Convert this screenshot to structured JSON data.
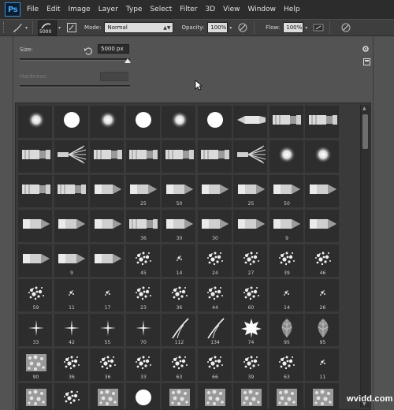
{
  "app": {
    "logo_text": "Ps"
  },
  "menu": [
    "File",
    "Edit",
    "Image",
    "Layer",
    "Type",
    "Select",
    "Filter",
    "3D",
    "View",
    "Window",
    "Help"
  ],
  "options_bar": {
    "brush_size_value": "5000",
    "mode_label": "Mode:",
    "mode_value": "Normal",
    "opacity_label": "Opacity:",
    "opacity_value": "100%",
    "flow_label": "Flow:",
    "flow_value": "100%"
  },
  "brush_panel": {
    "size_label": "Size:",
    "size_value": "5000 px",
    "hardness_label": "Hardness:",
    "hardness_value": ""
  },
  "brush_presets": [
    {
      "kind": "soft-round",
      "num": ""
    },
    {
      "kind": "hard-round",
      "num": ""
    },
    {
      "kind": "soft-round",
      "num": ""
    },
    {
      "kind": "hard-round",
      "num": ""
    },
    {
      "kind": "soft-round",
      "num": ""
    },
    {
      "kind": "hard-round",
      "num": ""
    },
    {
      "kind": "brush-tip",
      "num": ""
    },
    {
      "kind": "brush-flat",
      "num": ""
    },
    {
      "kind": "brush-flat",
      "num": ""
    },
    {
      "kind": "brush-flat",
      "num": ""
    },
    {
      "kind": "fan",
      "num": ""
    },
    {
      "kind": "brush-flat",
      "num": ""
    },
    {
      "kind": "brush-flat",
      "num": ""
    },
    {
      "kind": "brush-flat",
      "num": ""
    },
    {
      "kind": "brush-flat",
      "num": ""
    },
    {
      "kind": "fan",
      "num": ""
    },
    {
      "kind": "soft-round",
      "num": ""
    },
    {
      "kind": "soft-round",
      "num": ""
    },
    {
      "kind": "brush-flat",
      "num": ""
    },
    {
      "kind": "brush-flat",
      "num": ""
    },
    {
      "kind": "pencil",
      "num": ""
    },
    {
      "kind": "pencil",
      "num": "25"
    },
    {
      "kind": "pencil",
      "num": "50"
    },
    {
      "kind": "pencil",
      "num": ""
    },
    {
      "kind": "pencil",
      "num": "25"
    },
    {
      "kind": "pencil",
      "num": "50"
    },
    {
      "kind": "pencil",
      "num": ""
    },
    {
      "kind": "pencil",
      "num": ""
    },
    {
      "kind": "pencil",
      "num": ""
    },
    {
      "kind": "pencil",
      "num": ""
    },
    {
      "kind": "brush-flat",
      "num": "36"
    },
    {
      "kind": "pencil",
      "num": "30"
    },
    {
      "kind": "pencil",
      "num": "30"
    },
    {
      "kind": "pencil",
      "num": ""
    },
    {
      "kind": "pencil",
      "num": "9"
    },
    {
      "kind": "pencil",
      "num": ""
    },
    {
      "kind": "pencil",
      "num": ""
    },
    {
      "kind": "pencil",
      "num": "9"
    },
    {
      "kind": "pencil",
      "num": ""
    },
    {
      "kind": "spatter",
      "num": "45"
    },
    {
      "kind": "spatter-s",
      "num": "14"
    },
    {
      "kind": "spatter",
      "num": "24"
    },
    {
      "kind": "spatter",
      "num": "27"
    },
    {
      "kind": "spatter",
      "num": "39"
    },
    {
      "kind": "spatter",
      "num": "46"
    },
    {
      "kind": "spatter",
      "num": "59"
    },
    {
      "kind": "spatter-s",
      "num": "11"
    },
    {
      "kind": "spatter-s",
      "num": "17"
    },
    {
      "kind": "spatter",
      "num": "23"
    },
    {
      "kind": "spatter",
      "num": "36"
    },
    {
      "kind": "spatter",
      "num": "44"
    },
    {
      "kind": "spatter",
      "num": "60"
    },
    {
      "kind": "spatter-s",
      "num": "14"
    },
    {
      "kind": "spatter-s",
      "num": "26"
    },
    {
      "kind": "star",
      "num": "33"
    },
    {
      "kind": "star",
      "num": "42"
    },
    {
      "kind": "star",
      "num": "55"
    },
    {
      "kind": "star",
      "num": "70"
    },
    {
      "kind": "grass",
      "num": "112"
    },
    {
      "kind": "grass",
      "num": "134"
    },
    {
      "kind": "maple",
      "num": "74"
    },
    {
      "kind": "leaf",
      "num": "95"
    },
    {
      "kind": "leaf",
      "num": "95"
    },
    {
      "kind": "texture",
      "num": "90"
    },
    {
      "kind": "spatter",
      "num": "36"
    },
    {
      "kind": "spatter",
      "num": "36"
    },
    {
      "kind": "spatter",
      "num": "33"
    },
    {
      "kind": "spatter",
      "num": "63"
    },
    {
      "kind": "spatter",
      "num": "66"
    },
    {
      "kind": "spatter",
      "num": "39"
    },
    {
      "kind": "spatter",
      "num": "63"
    },
    {
      "kind": "spatter-s",
      "num": "11"
    },
    {
      "kind": "texture",
      "num": ""
    },
    {
      "kind": "spatter",
      "num": ""
    },
    {
      "kind": "texture",
      "num": ""
    },
    {
      "kind": "hard-round",
      "num": ""
    },
    {
      "kind": "texture",
      "num": ""
    },
    {
      "kind": "texture",
      "num": ""
    },
    {
      "kind": "texture",
      "num": ""
    },
    {
      "kind": "texture",
      "num": ""
    },
    {
      "kind": "texture",
      "num": ""
    }
  ],
  "watermark": "wvidd.com"
}
